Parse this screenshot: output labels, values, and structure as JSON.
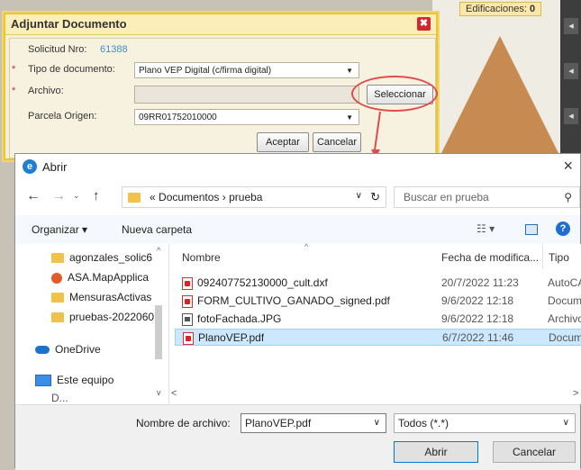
{
  "background": {
    "panel_label": "Edificaciones:",
    "panel_count": "0"
  },
  "adjuntar": {
    "title": "Adjuntar Documento",
    "close_label": "✖",
    "solicitud_label": "Solicitud Nro:",
    "solicitud_value": "61388",
    "tipo_label": "Tipo de documento:",
    "tipo_value": "Plano VEP Digital (c/firma digital)",
    "archivo_label": "Archivo:",
    "archivo_value": "",
    "seleccionar": "Seleccionar",
    "parcela_label": "Parcela Origen:",
    "parcela_value": "09RR01752010000",
    "aceptar": "Aceptar",
    "cancelar": "Cancelar",
    "required_mark": "*"
  },
  "abrir": {
    "title": "Abrir",
    "close": "×",
    "path_prefix": "«",
    "path_1": "Documentos",
    "path_sep": "›",
    "path_2": "prueba",
    "search_placeholder": "Buscar en prueba",
    "organizar": "Organizar ▾",
    "nueva_carpeta": "Nueva carpeta",
    "nav_items": [
      "agonzales_solic6",
      "ASA.MapApplica",
      "MensurasActivas",
      "pruebas-2022060",
      "OneDrive",
      "Este equipo",
      "D..."
    ],
    "columns": {
      "name": "Nombre",
      "date": "Fecha de modifica...",
      "type": "Tipo"
    },
    "files": [
      {
        "name": "092407752130000_cult.dxf",
        "date": "20/7/2022 11:23",
        "type": "AutoCAI"
      },
      {
        "name": "FORM_CULTIVO_GANADO_signed.pdf",
        "date": "9/6/2022 12:18",
        "type": "Docume"
      },
      {
        "name": "fotoFachada.JPG",
        "date": "9/6/2022 12:18",
        "type": "Archivo"
      },
      {
        "name": "PlanoVEP.pdf",
        "date": "6/7/2022 11:46",
        "type": "Docume"
      }
    ],
    "filename_label": "Nombre de archivo:",
    "filename_value": "PlanoVEP.pdf",
    "filter_value": "Todos (*.*)",
    "abrir_btn": "Abrir",
    "cancelar_btn": "Cancelar"
  }
}
